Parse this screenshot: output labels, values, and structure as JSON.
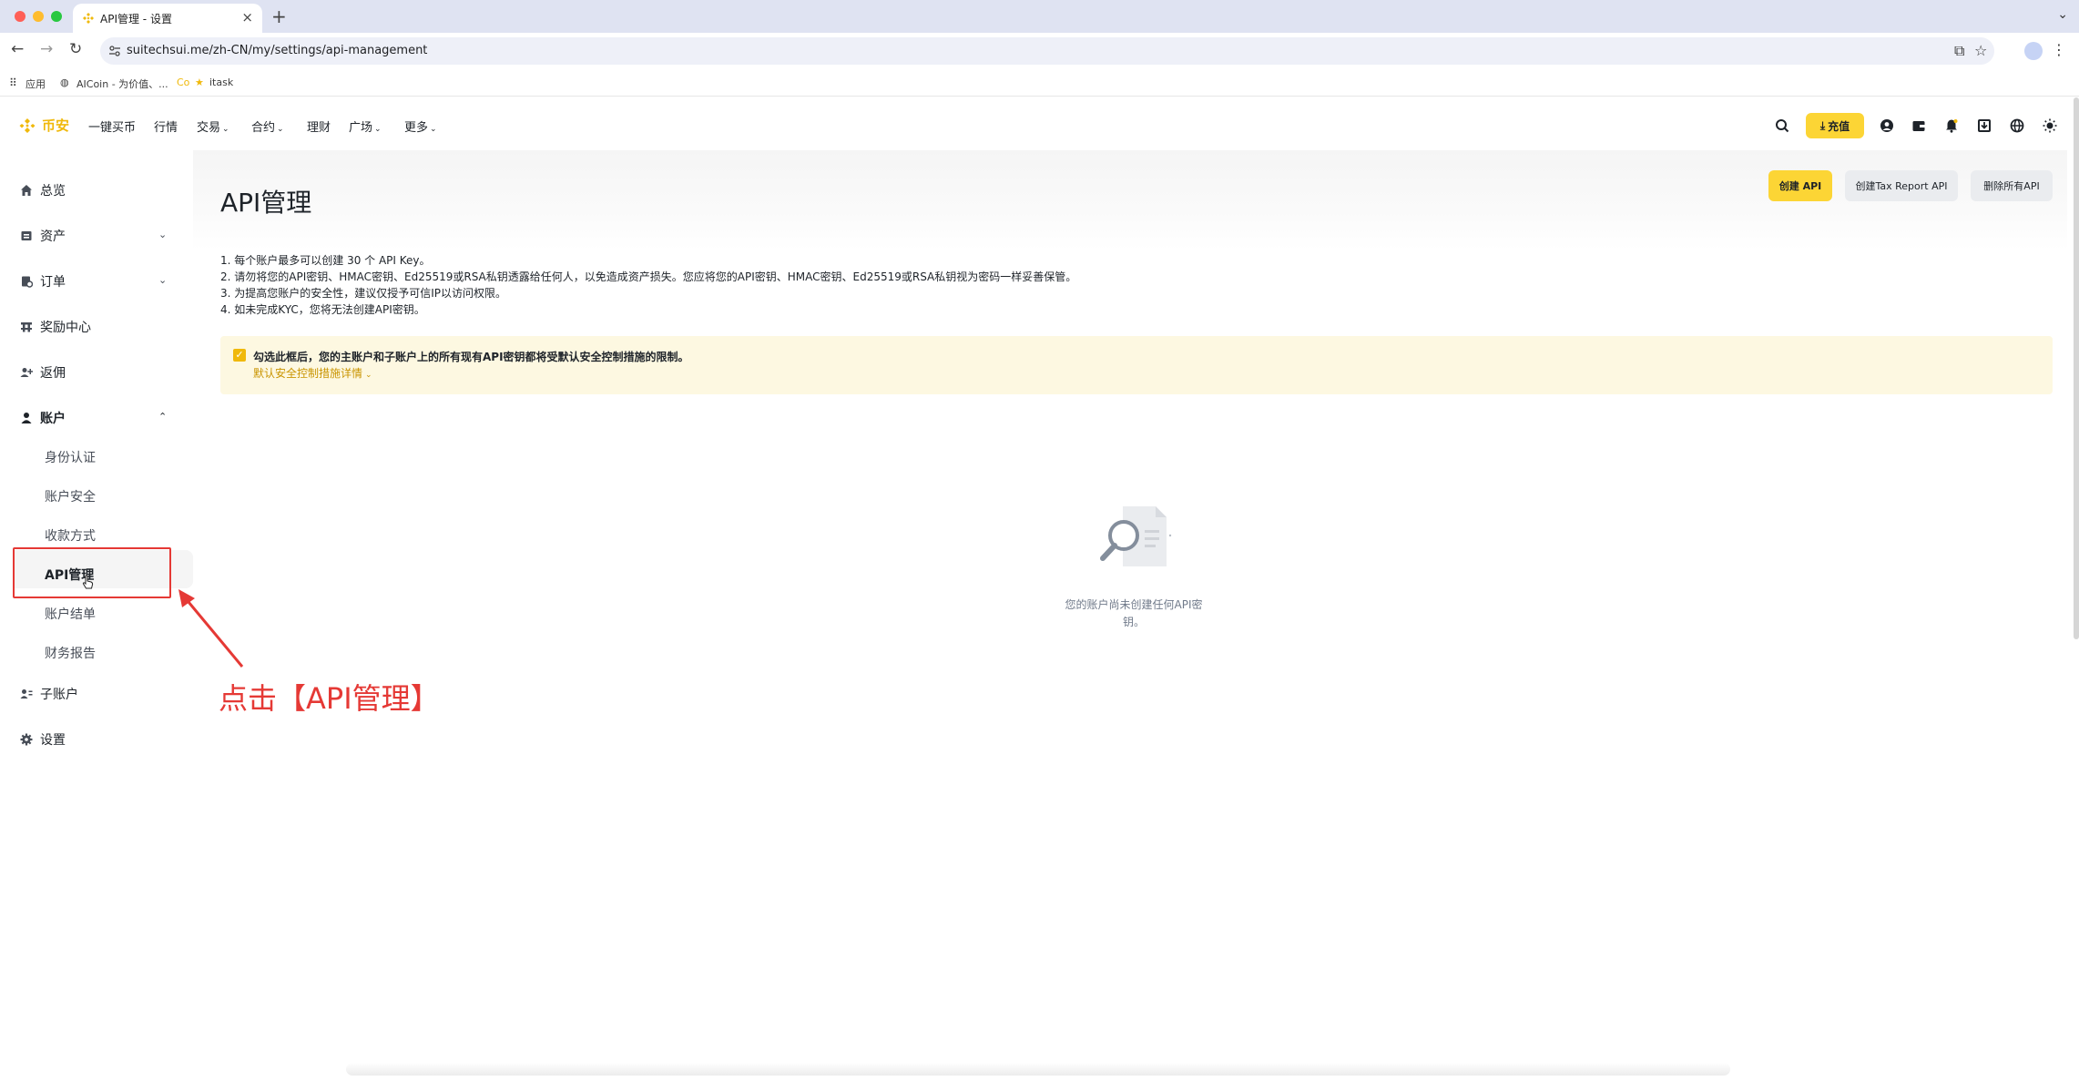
{
  "browser": {
    "tab_title": "API管理 - 设置",
    "url": "suitechsui.me/zh-CN/my/settings/api-management",
    "bookmarks": [
      "应用",
      "AICoin - 为价值、...",
      "Co",
      "itask"
    ]
  },
  "brand": {
    "name": "币安",
    "accent": "#f0b90b"
  },
  "topnav": {
    "items": [
      "一键买币",
      "行情",
      "交易",
      "合约",
      "理财",
      "广场",
      "更多"
    ],
    "deposit_label": "充值"
  },
  "sidebar": {
    "items": [
      {
        "label": "总览",
        "icon": "home-icon"
      },
      {
        "label": "资产",
        "icon": "wallet-icon"
      },
      {
        "label": "订单",
        "icon": "orders-icon"
      },
      {
        "label": "奖励中心",
        "icon": "rewards-icon"
      },
      {
        "label": "返佣",
        "icon": "referral-icon"
      },
      {
        "label": "账户",
        "icon": "user-icon"
      },
      {
        "label": "子账户",
        "icon": "sub-account-icon"
      },
      {
        "label": "设置",
        "icon": "gear-icon"
      }
    ],
    "account_sub": [
      "身份认证",
      "账户安全",
      "收款方式",
      "API管理",
      "账户结单",
      "财务报告"
    ]
  },
  "main": {
    "title": "API管理",
    "buttons": {
      "create": "创建 API",
      "create_tax": "创建Tax Report API",
      "delete_all": "删除所有API"
    },
    "notes": [
      "1. 每个账户最多可以创建 30 个 API Key。",
      "2. 请勿将您的API密钥、HMAC密钥、Ed25519或RSA私钥透露给任何人，以免造成资产损失。您应将您的API密钥、HMAC密钥、Ed25519或RSA私钥视为密码一样妥善保管。",
      "3. 为提高您账户的安全性，建议仅授予可信IP以访问权限。",
      "4. 如未完成KYC，您将无法创建API密钥。"
    ],
    "notice": {
      "text": "勾选此框后，您的主账户和子账户上的所有现有API密钥都将受默认安全控制措施的限制。",
      "link": "默认安全控制措施详情"
    },
    "empty_text": "您的账户尚未创建任何API密钥。"
  },
  "annotation": {
    "text": "点击【API管理】",
    "color": "#e53935"
  }
}
